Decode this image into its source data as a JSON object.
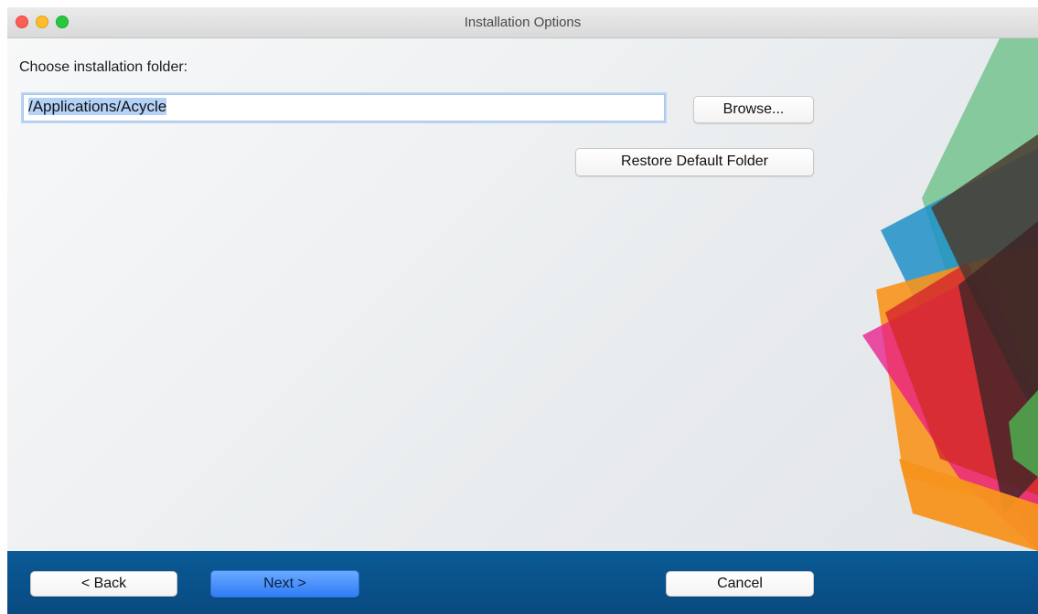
{
  "window": {
    "title": "Installation Options"
  },
  "form": {
    "folder_label": "Choose installation folder:",
    "folder_path": "/Applications/Acycle",
    "browse_label": "Browse...",
    "restore_label": "Restore Default Folder"
  },
  "footer": {
    "back_label": "< Back",
    "next_label": "Next >",
    "cancel_label": "Cancel"
  },
  "colors": {
    "footer_bg": "#0a5a96",
    "next_button": "#2f7cf6",
    "selection": "#b4d2f8"
  }
}
